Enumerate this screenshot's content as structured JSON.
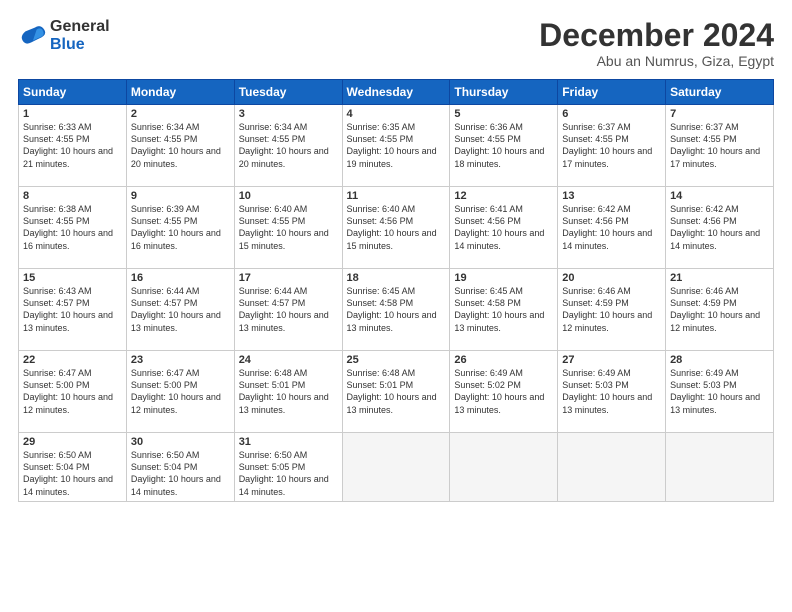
{
  "logo": {
    "general": "General",
    "blue": "Blue"
  },
  "title": "December 2024",
  "location": "Abu an Numrus, Giza, Egypt",
  "days_header": [
    "Sunday",
    "Monday",
    "Tuesday",
    "Wednesday",
    "Thursday",
    "Friday",
    "Saturday"
  ],
  "weeks": [
    [
      {
        "day": "1",
        "sunrise": "6:33 AM",
        "sunset": "4:55 PM",
        "daylight": "10 hours and 21 minutes."
      },
      {
        "day": "2",
        "sunrise": "6:34 AM",
        "sunset": "4:55 PM",
        "daylight": "10 hours and 20 minutes."
      },
      {
        "day": "3",
        "sunrise": "6:34 AM",
        "sunset": "4:55 PM",
        "daylight": "10 hours and 20 minutes."
      },
      {
        "day": "4",
        "sunrise": "6:35 AM",
        "sunset": "4:55 PM",
        "daylight": "10 hours and 19 minutes."
      },
      {
        "day": "5",
        "sunrise": "6:36 AM",
        "sunset": "4:55 PM",
        "daylight": "10 hours and 18 minutes."
      },
      {
        "day": "6",
        "sunrise": "6:37 AM",
        "sunset": "4:55 PM",
        "daylight": "10 hours and 17 minutes."
      },
      {
        "day": "7",
        "sunrise": "6:37 AM",
        "sunset": "4:55 PM",
        "daylight": "10 hours and 17 minutes."
      }
    ],
    [
      {
        "day": "8",
        "sunrise": "6:38 AM",
        "sunset": "4:55 PM",
        "daylight": "10 hours and 16 minutes."
      },
      {
        "day": "9",
        "sunrise": "6:39 AM",
        "sunset": "4:55 PM",
        "daylight": "10 hours and 16 minutes."
      },
      {
        "day": "10",
        "sunrise": "6:40 AM",
        "sunset": "4:55 PM",
        "daylight": "10 hours and 15 minutes."
      },
      {
        "day": "11",
        "sunrise": "6:40 AM",
        "sunset": "4:56 PM",
        "daylight": "10 hours and 15 minutes."
      },
      {
        "day": "12",
        "sunrise": "6:41 AM",
        "sunset": "4:56 PM",
        "daylight": "10 hours and 14 minutes."
      },
      {
        "day": "13",
        "sunrise": "6:42 AM",
        "sunset": "4:56 PM",
        "daylight": "10 hours and 14 minutes."
      },
      {
        "day": "14",
        "sunrise": "6:42 AM",
        "sunset": "4:56 PM",
        "daylight": "10 hours and 14 minutes."
      }
    ],
    [
      {
        "day": "15",
        "sunrise": "6:43 AM",
        "sunset": "4:57 PM",
        "daylight": "10 hours and 13 minutes."
      },
      {
        "day": "16",
        "sunrise": "6:44 AM",
        "sunset": "4:57 PM",
        "daylight": "10 hours and 13 minutes."
      },
      {
        "day": "17",
        "sunrise": "6:44 AM",
        "sunset": "4:57 PM",
        "daylight": "10 hours and 13 minutes."
      },
      {
        "day": "18",
        "sunrise": "6:45 AM",
        "sunset": "4:58 PM",
        "daylight": "10 hours and 13 minutes."
      },
      {
        "day": "19",
        "sunrise": "6:45 AM",
        "sunset": "4:58 PM",
        "daylight": "10 hours and 13 minutes."
      },
      {
        "day": "20",
        "sunrise": "6:46 AM",
        "sunset": "4:59 PM",
        "daylight": "10 hours and 12 minutes."
      },
      {
        "day": "21",
        "sunrise": "6:46 AM",
        "sunset": "4:59 PM",
        "daylight": "10 hours and 12 minutes."
      }
    ],
    [
      {
        "day": "22",
        "sunrise": "6:47 AM",
        "sunset": "5:00 PM",
        "daylight": "10 hours and 12 minutes."
      },
      {
        "day": "23",
        "sunrise": "6:47 AM",
        "sunset": "5:00 PM",
        "daylight": "10 hours and 12 minutes."
      },
      {
        "day": "24",
        "sunrise": "6:48 AM",
        "sunset": "5:01 PM",
        "daylight": "10 hours and 13 minutes."
      },
      {
        "day": "25",
        "sunrise": "6:48 AM",
        "sunset": "5:01 PM",
        "daylight": "10 hours and 13 minutes."
      },
      {
        "day": "26",
        "sunrise": "6:49 AM",
        "sunset": "5:02 PM",
        "daylight": "10 hours and 13 minutes."
      },
      {
        "day": "27",
        "sunrise": "6:49 AM",
        "sunset": "5:03 PM",
        "daylight": "10 hours and 13 minutes."
      },
      {
        "day": "28",
        "sunrise": "6:49 AM",
        "sunset": "5:03 PM",
        "daylight": "10 hours and 13 minutes."
      }
    ],
    [
      {
        "day": "29",
        "sunrise": "6:50 AM",
        "sunset": "5:04 PM",
        "daylight": "10 hours and 14 minutes."
      },
      {
        "day": "30",
        "sunrise": "6:50 AM",
        "sunset": "5:04 PM",
        "daylight": "10 hours and 14 minutes."
      },
      {
        "day": "31",
        "sunrise": "6:50 AM",
        "sunset": "5:05 PM",
        "daylight": "10 hours and 14 minutes."
      },
      null,
      null,
      null,
      null
    ]
  ]
}
